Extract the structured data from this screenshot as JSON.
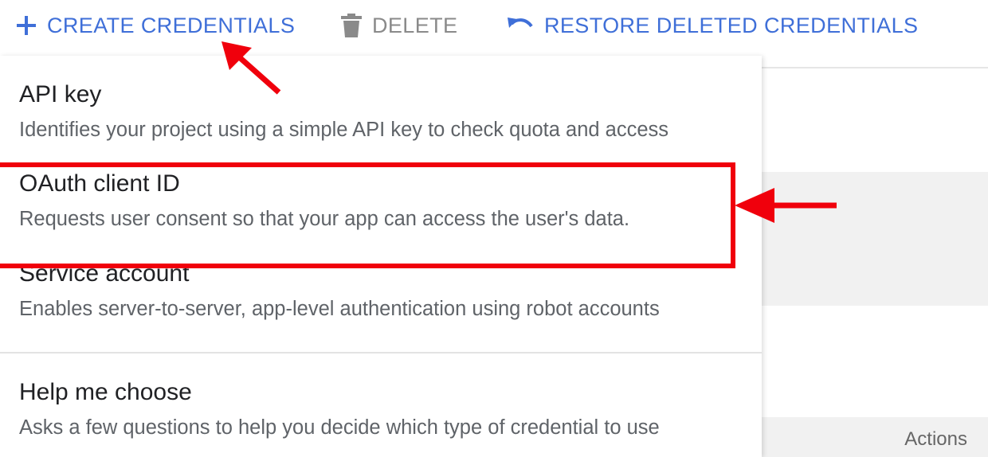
{
  "toolbar": {
    "create_label": "CREATE CREDENTIALS",
    "delete_label": "DELETE",
    "restore_label": "RESTORE DELETED CREDENTIALS"
  },
  "menu": {
    "items": [
      {
        "title": "API key",
        "description": "Identifies your project using a simple API key to check quota and access"
      },
      {
        "title": "OAuth client ID",
        "description": "Requests user consent so that your app can access the user's data."
      },
      {
        "title": "Service account",
        "description": "Enables server-to-server, app-level authentication using robot accounts"
      },
      {
        "title": "Help me choose",
        "description": "Asks a few questions to help you decide which type of credential to use"
      }
    ]
  },
  "table": {
    "actions_header": "Actions"
  },
  "colors": {
    "accent_blue": "#3f6fd8",
    "annotation_red": "#f0000c",
    "disabled_gray": "#8a8a8a"
  },
  "icons": {
    "create": "plus-icon",
    "delete": "trash-icon",
    "restore": "undo-icon"
  }
}
